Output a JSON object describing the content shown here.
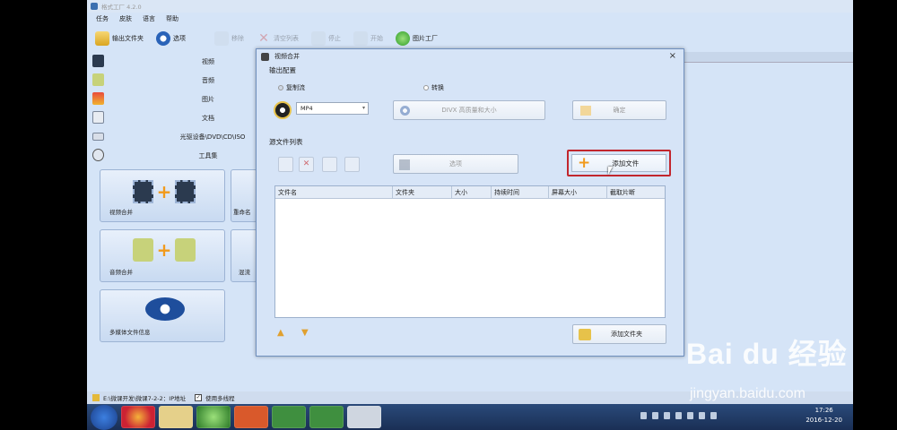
{
  "app": {
    "title": "格式工厂 4.2.0",
    "menu": [
      "任务",
      "皮肤",
      "语言",
      "帮助"
    ],
    "toolbar": [
      {
        "label": "输出文件夹",
        "icon": "folder-icon",
        "enabled": true
      },
      {
        "label": "选项",
        "icon": "options-icon",
        "enabled": true
      },
      {
        "label": "移除",
        "icon": "remove-icon",
        "enabled": false
      },
      {
        "label": "清空列表",
        "icon": "clear-icon",
        "enabled": false
      },
      {
        "label": "停止",
        "icon": "stop-icon",
        "enabled": false
      },
      {
        "label": "开始",
        "icon": "start-icon",
        "enabled": false
      },
      {
        "label": "图片工厂",
        "icon": "picture-factory-icon",
        "enabled": true
      }
    ]
  },
  "sidebar": {
    "categories": [
      {
        "label": "视频",
        "icon": "video-icon"
      },
      {
        "label": "音频",
        "icon": "audio-icon"
      },
      {
        "label": "图片",
        "icon": "picture-icon"
      },
      {
        "label": "文档",
        "icon": "document-icon"
      },
      {
        "label": "光驱设备\\DVD\\CD\\ISO",
        "icon": "optical-drive-icon"
      },
      {
        "label": "工具集",
        "icon": "toolbox-icon"
      }
    ],
    "tiles": [
      {
        "label": "视频合并",
        "icon": "video-merge-icon"
      },
      {
        "label": "重命名",
        "icon": "rename-icon"
      },
      {
        "label": "音频合并",
        "icon": "audio-merge-icon"
      },
      {
        "label": "混流",
        "icon": "mux-icon"
      },
      {
        "label": "多媒体文件信息",
        "icon": "media-info-icon"
      }
    ]
  },
  "status": {
    "path": "E:\\微课开发\\微课7-2-2：IP地址",
    "multithread_label": "使用多线程",
    "multithread_checked": true
  },
  "dialog": {
    "title": "视频合并",
    "output_config_label": "输出配置",
    "radio_copy": "复制流",
    "radio_convert": "转换",
    "format_value": "MP4",
    "size_button": "DIVX 高质量和大小",
    "ok_button": "确定",
    "source_list_label": "源文件列表",
    "options_button": "选项",
    "add_file_button": "添加文件",
    "add_folder_button": "添加文件夹",
    "columns": [
      "文件名",
      "文件夹",
      "大小",
      "持续时间",
      "屏幕大小",
      "截取片断"
    ]
  },
  "taskbar": {
    "time": "17:26",
    "date": "2016-12-20"
  },
  "watermark": {
    "brand": "Bai  du 经验",
    "url": "jingyan.baidu.com"
  }
}
